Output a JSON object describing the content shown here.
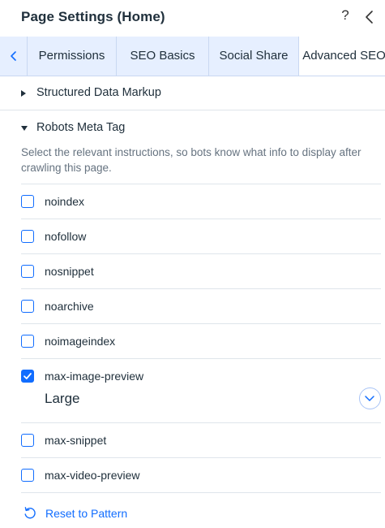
{
  "header": {
    "title": "Page Settings (Home)",
    "help_symbol": "?"
  },
  "tabs": [
    {
      "label": "Permissions",
      "active": false
    },
    {
      "label": "SEO Basics",
      "active": false
    },
    {
      "label": "Social Share",
      "active": false
    },
    {
      "label": "Advanced SEO",
      "active": true
    }
  ],
  "sections": {
    "structured_data": {
      "label": "Structured Data Markup",
      "expanded": false
    },
    "robots": {
      "label": "Robots Meta Tag",
      "expanded": true,
      "description": "Select the relevant instructions, so bots know what info to display after crawling this page."
    }
  },
  "robots_options": [
    {
      "label": "noindex",
      "checked": false
    },
    {
      "label": "nofollow",
      "checked": false
    },
    {
      "label": "nosnippet",
      "checked": false
    },
    {
      "label": "noarchive",
      "checked": false
    },
    {
      "label": "noimageindex",
      "checked": false
    },
    {
      "label": "max-image-preview",
      "checked": true
    },
    {
      "label": "max-snippet",
      "checked": false
    },
    {
      "label": "max-video-preview",
      "checked": false
    }
  ],
  "max_image_preview": {
    "selected": "Large"
  },
  "footer": {
    "reset_label": "Reset to Pattern"
  },
  "colors": {
    "accent": "#116dff",
    "tab_bar": "#e6efff",
    "text": "#20303c",
    "muted": "#667380"
  },
  "icons": {
    "help": "question-mark",
    "back": "chevron-left-icon",
    "scroll_left": "chevron-left-icon",
    "select": "chevron-down-icon",
    "reset": "undo-icon",
    "check": "checkmark-icon"
  }
}
